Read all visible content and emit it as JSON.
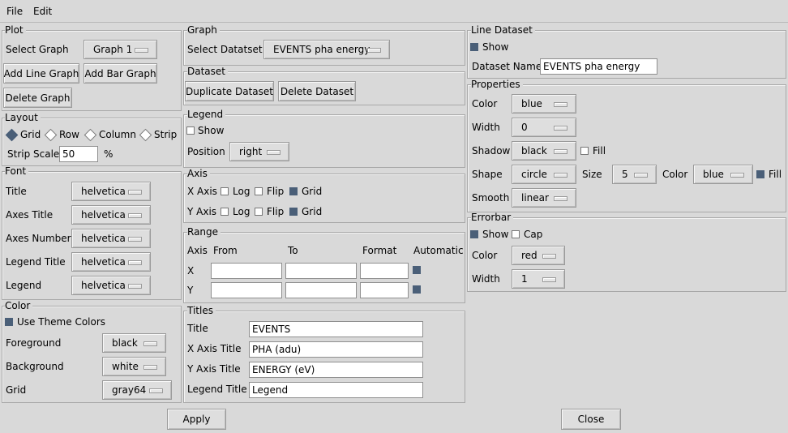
{
  "menu": {
    "file": "File",
    "edit": "Edit"
  },
  "plot": {
    "title": "Plot",
    "select_graph_label": "Select Graph",
    "select_graph_value": "Graph 1",
    "add_line": "Add Line Graph",
    "add_bar": "Add Bar Graph",
    "delete_graph": "Delete Graph"
  },
  "layout": {
    "title": "Layout",
    "options": [
      "Grid",
      "Row",
      "Column",
      "Strip"
    ],
    "selected": "Grid",
    "strip_scale_label": "Strip Scale",
    "strip_scale_value": "50",
    "strip_scale_unit": "%"
  },
  "font": {
    "title": "Font",
    "rows": [
      {
        "label": "Title",
        "value": "helvetica"
      },
      {
        "label": "Axes Title",
        "value": "helvetica"
      },
      {
        "label": "Axes Number",
        "value": "helvetica"
      },
      {
        "label": "Legend Title",
        "value": "helvetica"
      },
      {
        "label": "Legend",
        "value": "helvetica"
      }
    ]
  },
  "color": {
    "title": "Color",
    "use_theme_label": "Use Theme Colors",
    "use_theme_checked": true,
    "foreground_label": "Foreground",
    "foreground_value": "black",
    "background_label": "Background",
    "background_value": "white",
    "grid_label": "Grid",
    "grid_value": "gray64"
  },
  "graph": {
    "title": "Graph",
    "select_dataset_label": "Select Datatset",
    "select_dataset_value": "EVENTS pha energy"
  },
  "dataset": {
    "title": "Dataset",
    "duplicate": "Duplicate Dataset",
    "delete": "Delete Dataset"
  },
  "legend": {
    "title": "Legend",
    "show_label": "Show",
    "show_checked": false,
    "position_label": "Position",
    "position_value": "right"
  },
  "axis": {
    "title": "Axis",
    "x_label": "X Axis",
    "y_label": "Y Axis",
    "log_label": "Log",
    "flip_label": "Flip",
    "grid_label": "Grid",
    "x_log": false,
    "x_flip": false,
    "x_grid": true,
    "y_log": false,
    "y_flip": false,
    "y_grid": true
  },
  "range": {
    "title": "Range",
    "col_axis": "Axis",
    "col_from": "From",
    "col_to": "To",
    "col_format": "Format",
    "col_automatic": "Automatic",
    "x_label": "X",
    "y_label": "Y",
    "x_from": "",
    "x_to": "",
    "x_format": "",
    "x_auto": true,
    "y_from": "",
    "y_to": "",
    "y_format": "",
    "y_auto": true
  },
  "titles": {
    "title": "Titles",
    "title_label": "Title",
    "title_value": "EVENTS",
    "x_label": "X Axis Title",
    "x_value": "PHA (adu)",
    "y_label": "Y Axis Title",
    "y_value": "ENERGY (eV)",
    "legend_label": "Legend Title",
    "legend_value": "Legend"
  },
  "line_dataset": {
    "title": "Line Dataset",
    "show_label": "Show",
    "show_checked": true,
    "name_label": "Dataset Name",
    "name_value": "EVENTS pha energy"
  },
  "properties": {
    "title": "Properties",
    "color_label": "Color",
    "color_value": "blue",
    "width_label": "Width",
    "width_value": "0",
    "shadow_label": "Shadow",
    "shadow_value": "black",
    "shadow_fill_label": "Fill",
    "shadow_fill_checked": false,
    "shape_label": "Shape",
    "shape_value": "circle",
    "size_label": "Size",
    "size_value": "5",
    "shape_color_label": "Color",
    "shape_color_value": "blue",
    "shape_fill_label": "Fill",
    "shape_fill_checked": true,
    "smooth_label": "Smooth",
    "smooth_value": "linear"
  },
  "errorbar": {
    "title": "Errorbar",
    "show_label": "Show",
    "show_checked": true,
    "cap_label": "Cap",
    "cap_checked": false,
    "color_label": "Color",
    "color_value": "red",
    "width_label": "Width",
    "width_value": "1"
  },
  "footer": {
    "apply": "Apply",
    "close": "Close"
  }
}
